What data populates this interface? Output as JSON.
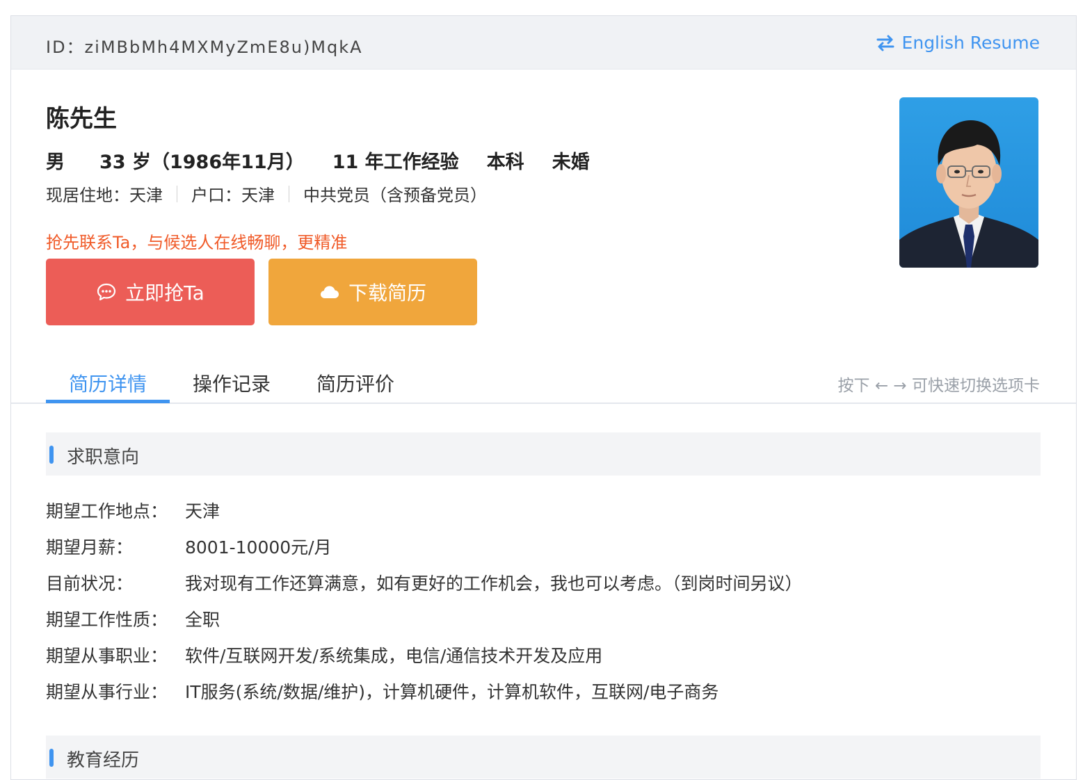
{
  "header": {
    "id_text": "ID：ziMBbMh4MXMyZmE8u)MqkA",
    "english_link": "English Resume"
  },
  "profile": {
    "name": "陈先生",
    "gender": "男",
    "age": "33 岁（1986年11月）",
    "experience": "11 年工作经验",
    "education": "本科",
    "marital": "未婚",
    "residence": "现居住地：天津",
    "hukou": "户口：天津",
    "political": "中共党员（含预备党员）",
    "promo": "抢先联系Ta，与候选人在线畅聊，更精准"
  },
  "actions": {
    "grab_label": "立即抢Ta",
    "download_label": "下载简历"
  },
  "tabs": {
    "items": [
      {
        "label": "简历详情",
        "active": true
      },
      {
        "label": "操作记录",
        "active": false
      },
      {
        "label": "简历评价",
        "active": false
      }
    ],
    "hint": "按下 ← → 可快速切换选项卡"
  },
  "sections": {
    "intent_title": "求职意向",
    "education_title": "教育经历"
  },
  "intent": [
    {
      "label": "期望工作地点：",
      "value": "天津"
    },
    {
      "label": "期望月薪：",
      "value": "8001-10000元/月"
    },
    {
      "label": "目前状况：",
      "value": "我对现有工作还算满意，如有更好的工作机会，我也可以考虑。（到岗时间另议）"
    },
    {
      "label": "期望工作性质：",
      "value": "全职"
    },
    {
      "label": "期望从事职业：",
      "value": "软件/互联网开发/系统集成，电信/通信技术开发及应用"
    },
    {
      "label": "期望从事行业：",
      "value": "IT服务(系统/数据/维护)，计算机硬件，计算机软件，互联网/电子商务"
    }
  ],
  "colors": {
    "accent": "#3f94f0",
    "grab_button": "#ec5d57",
    "download_button": "#f0a63c",
    "promo_text": "#f05a28"
  },
  "icons": {
    "english_link": "swap-arrows-icon",
    "grab_button": "chat-bubble-icon",
    "download_button": "cloud-icon"
  }
}
